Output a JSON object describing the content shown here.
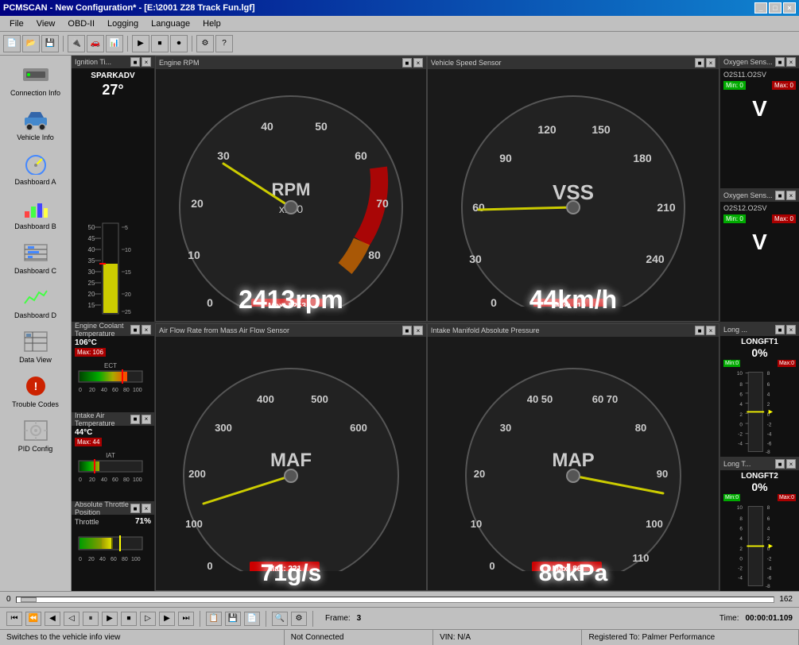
{
  "window": {
    "title": "PCMSCAN - New Configuration* - [E:\\2001 Z28 Track Fun.lgf]",
    "controls": [
      "_",
      "□",
      "×"
    ]
  },
  "menubar": {
    "items": [
      "File",
      "View",
      "OBD-II",
      "Logging",
      "Language",
      "Help"
    ]
  },
  "sidebar": {
    "items": [
      {
        "id": "connection-info",
        "label": "Connection Info",
        "icon": "🔌"
      },
      {
        "id": "vehicle-info",
        "label": "Vehicle Info",
        "icon": "🚗"
      },
      {
        "id": "dashboard-a",
        "label": "Dashboard A",
        "icon": "🔵"
      },
      {
        "id": "dashboard-b",
        "label": "Dashboard B",
        "icon": "📊"
      },
      {
        "id": "dashboard-c",
        "label": "Dashboard C",
        "icon": "📋"
      },
      {
        "id": "dashboard-d",
        "label": "Dashboard D",
        "icon": "📈"
      },
      {
        "id": "data-view",
        "label": "Data View",
        "icon": "📋"
      },
      {
        "id": "trouble-codes",
        "label": "Trouble Codes",
        "icon": "🚨"
      },
      {
        "id": "pid-config",
        "label": "PID Config",
        "icon": "⚙️"
      }
    ]
  },
  "gauges": {
    "rpm": {
      "title": "Engine RPM",
      "value": "2413rpm",
      "max_label": "Max: 8253",
      "unit": "RPM",
      "multiplier": "x100",
      "current": 2413,
      "max_val": 8000
    },
    "vss": {
      "title": "Vehicle Speed Sensor",
      "value": "44km/h",
      "max_label": "Max: 119",
      "unit": "VSS",
      "current": 44,
      "max_val": 240
    },
    "maf": {
      "title": "Air Flow Rate from Mass Air Flow Sensor",
      "value": "71g/s",
      "max_label": "Max: 221",
      "unit": "MAF",
      "current": 71,
      "max_val": 600
    },
    "map": {
      "title": "Intake Manifold Absolute Pressure",
      "value": "86kPa",
      "max_label": "Max: 86",
      "unit": "MAP",
      "current": 86,
      "max_val": 110
    }
  },
  "small_panels": {
    "ignition": {
      "title": "Ignition Ti...",
      "label": "SPARKADV",
      "value": "27°",
      "bar_value": 27,
      "bar_max": 60
    },
    "ect": {
      "title": "Engine Coolant Temperature",
      "value": "106°C",
      "max_label": "Max: 106",
      "label": "ECT"
    },
    "iat": {
      "title": "Intake Air Temperature",
      "value": "44°C",
      "max_label": "Max: 44",
      "label": "IAT"
    },
    "throttle": {
      "title": "Absolute Throttle Position",
      "value": "71%",
      "label": "Throttle",
      "bar_value": 71,
      "tick_labels": [
        "0",
        "20",
        "40",
        "60",
        "80",
        "100"
      ]
    },
    "o2s11": {
      "title": "Oxygen Sens...",
      "label": "O2S11.O2SV",
      "min_label": "Min: 0",
      "max_label": "Max: 0",
      "value": "V"
    },
    "o2s12": {
      "title": "Oxygen Sens...",
      "label": "O2S12.O2SV",
      "min_label": "Min: 0",
      "max_label": "Max: 0",
      "value": "V"
    },
    "longft1": {
      "title": "Long ...",
      "label": "LONGFT1",
      "value": "0%"
    },
    "longft2": {
      "title": "Long T...",
      "label": "LONGFT2",
      "value": "0%"
    }
  },
  "transport": {
    "frame_label": "Frame:",
    "frame_value": "3",
    "time_label": "Time:",
    "time_value": "00:00:01.109"
  },
  "scrollbar": {
    "left_val": "0",
    "right_val": "162"
  },
  "statusbar": {
    "hint": "Switches to the vehicle info view",
    "connection": "Not Connected",
    "vin": "VIN: N/A",
    "registered": "Registered To: Palmer Performance"
  }
}
